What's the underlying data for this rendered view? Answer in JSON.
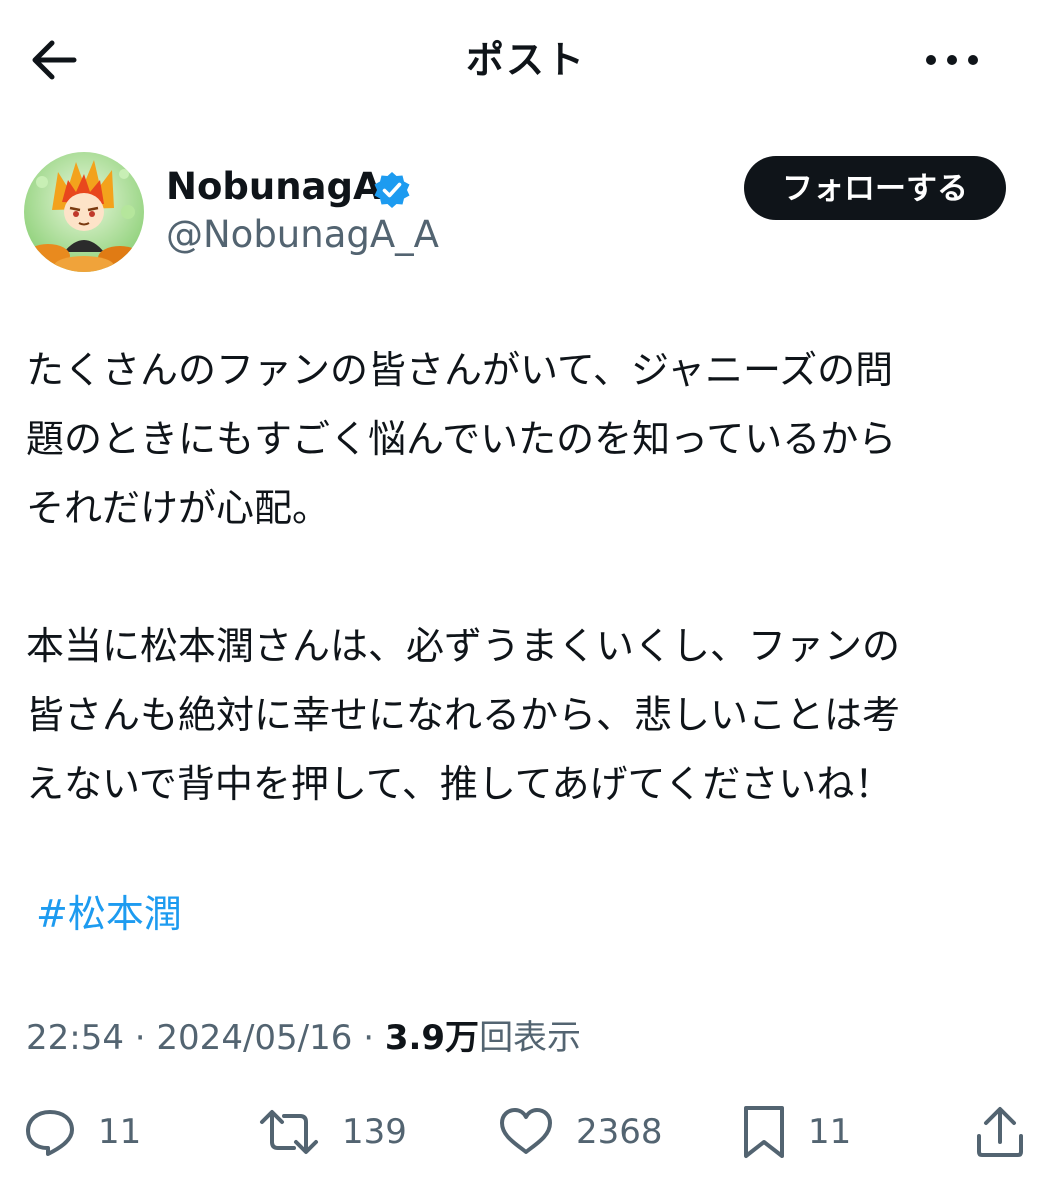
{
  "header": {
    "title": "ポスト",
    "back_icon": "arrow-left-icon",
    "more_icon": "more-horizontal-icon"
  },
  "author": {
    "display_name": "NobunagA",
    "handle": "@NobunagA_A",
    "verified": true,
    "verified_color": "#1d9bf0",
    "follow_label": "フォローする"
  },
  "post": {
    "lines": [
      "たくさんのファンの皆さんがいて、ジャニーズの問",
      "題のときにもすごく悩んでいたのを知っているから",
      "それだけが心配。",
      "",
      "本当に松本潤さんは、必ずうまくいくし、ファンの",
      "皆さんも絶対に幸せになれるから、悲しいことは考",
      "えないで背中を押して、推してあげてくださいね！"
    ],
    "hashtag": "#松本潤",
    "hashtag_color": "#1d9bf0"
  },
  "meta": {
    "time": "22:54",
    "separator": " · ",
    "date": "2024/05/16",
    "views_count": "3.9万",
    "views_label": "回表示"
  },
  "actions": {
    "reply_count": "11",
    "repost_count": "139",
    "like_count": "2368",
    "bookmark_count": "11"
  },
  "colors": {
    "text": "#0f1419",
    "secondary": "#536471",
    "accent": "#1d9bf0"
  }
}
